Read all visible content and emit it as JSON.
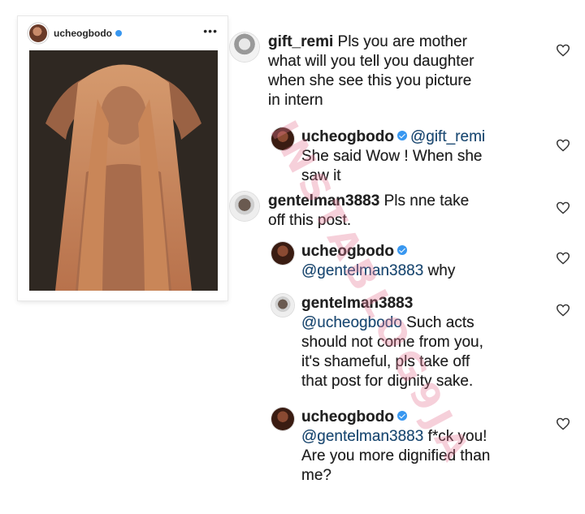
{
  "post": {
    "username": "ucheogbodo",
    "more_label": "•••"
  },
  "comments": [
    {
      "username": "gift_remi",
      "verified": false,
      "lines": [
        "Pls you are mother",
        "what will you tell you daughter",
        "when she see this you picture",
        "in intern"
      ],
      "first_line_rest": "Pls you are mother"
    },
    {
      "username": "ucheogbodo",
      "verified": true,
      "mention": "@gift_remi",
      "lines": [
        "She said Wow ! When she",
        "saw it"
      ]
    },
    {
      "username": "gentelman3883",
      "verified": false,
      "first_line_rest": "Pls nne take",
      "lines": [
        "off this post."
      ]
    },
    {
      "username": "ucheogbodo",
      "verified": true,
      "mention": "@gentelman3883",
      "rest": "why"
    },
    {
      "username": "gentelman3883",
      "verified": false,
      "mention": "@ucheogbodo",
      "first_rest": "Such acts",
      "lines": [
        "should not come from you,",
        "it's shameful, pls take off",
        "that post for dignity sake."
      ]
    },
    {
      "username": "ucheogbodo",
      "verified": true,
      "mention": "@gentelman3883",
      "rest": "f*ck you!",
      "lines": [
        "Are you more dignified than",
        "me?"
      ]
    }
  ],
  "watermark": "INSTABLOG9JA",
  "colors": {
    "verified": "#3897f0",
    "mention": "#1d4e7a",
    "watermark": "#e67896"
  }
}
